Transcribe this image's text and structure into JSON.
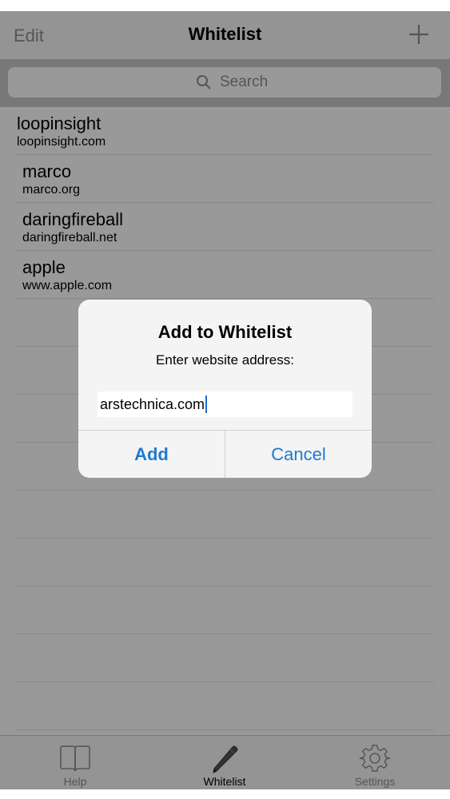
{
  "navbar": {
    "edit_label": "Edit",
    "title": "Whitelist",
    "add_icon": "plus-icon"
  },
  "search": {
    "placeholder": "Search",
    "icon": "search-icon"
  },
  "whitelist": {
    "items": [
      {
        "name": "loopinsight",
        "domain": "loopinsight.com"
      },
      {
        "name": "marco",
        "domain": "marco.org"
      },
      {
        "name": "daringfireball",
        "domain": "daringfireball.net"
      },
      {
        "name": "apple",
        "domain": "www.apple.com"
      }
    ]
  },
  "alert": {
    "title": "Add to Whitelist",
    "message": "Enter website address:",
    "input_value": "arstechnica.com",
    "add_label": "Add",
    "cancel_label": "Cancel"
  },
  "tabbar": {
    "tabs": [
      {
        "label": "Help",
        "icon": "book-icon"
      },
      {
        "label": "Whitelist",
        "icon": "pencil-icon"
      },
      {
        "label": "Settings",
        "icon": "gear-icon"
      }
    ]
  },
  "colors": {
    "accent": "#1f7ad1",
    "inactive": "#8e8e93"
  }
}
